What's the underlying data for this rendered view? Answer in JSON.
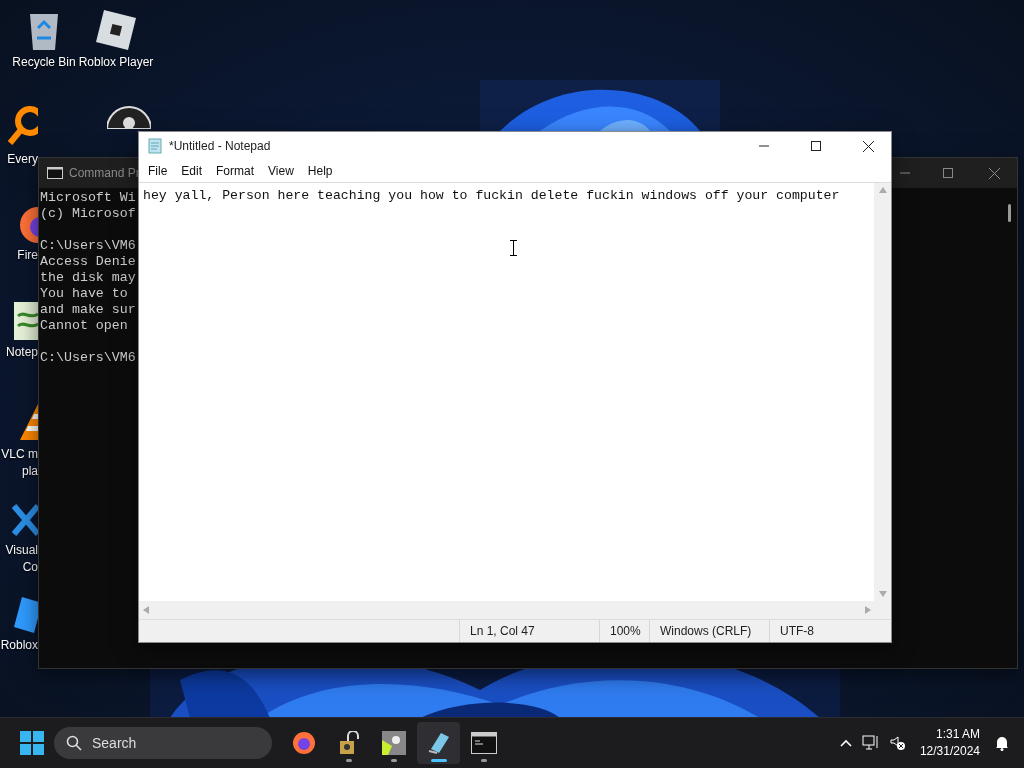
{
  "desktop_icons": [
    {
      "kind": "recycle",
      "label": "Recycle Bin"
    },
    {
      "kind": "roblox-player",
      "label": "Roblox Player"
    },
    {
      "kind": "everything",
      "label": "Every"
    },
    {
      "kind": "obs"
    },
    {
      "kind": "firefox",
      "label": "Fire"
    },
    {
      "kind": "notepad",
      "label": "Notep"
    },
    {
      "kind": "vlc",
      "label": "VLC m",
      "label_2": "pla"
    },
    {
      "kind": "vscode",
      "label": "Visual",
      "label_2": "Co"
    },
    {
      "kind": "roblox",
      "label": "Roblox"
    }
  ],
  "command_window": {
    "title": "Command Pr",
    "blocks": [
      [
        "Microsoft Wi",
        "(c) Microsof"
      ],
      [
        "C:\\Users\\VM6",
        "Access Denie",
        "the disk may",
        "You have to",
        "and make sur",
        "Cannot open"
      ],
      [
        "C:\\Users\\VM6"
      ]
    ]
  },
  "notepad": {
    "title": "*Untitled - Notepad",
    "menu": [
      "File",
      "Edit",
      "Format",
      "View",
      "Help"
    ],
    "text": "hey yall, Person here teaching you how to fuckin delete fuckin windows off your computer",
    "status": [
      "Ln 1, Col 47",
      "100%",
      "Windows (CRLF)",
      "UTF-8"
    ]
  },
  "taskbar": {
    "search": {
      "placeholder": "Search"
    },
    "apps": [
      {
        "kind": "firefox",
        "running": false,
        "active": false
      },
      {
        "kind": "lock",
        "running": true,
        "active": false
      },
      {
        "kind": "tool",
        "running": true,
        "active": false
      },
      {
        "kind": "notepad",
        "running": true,
        "active": true
      },
      {
        "kind": "terminal",
        "running": true,
        "active": false
      }
    ],
    "time": "1:31 AM",
    "date": "12/31/2024"
  }
}
